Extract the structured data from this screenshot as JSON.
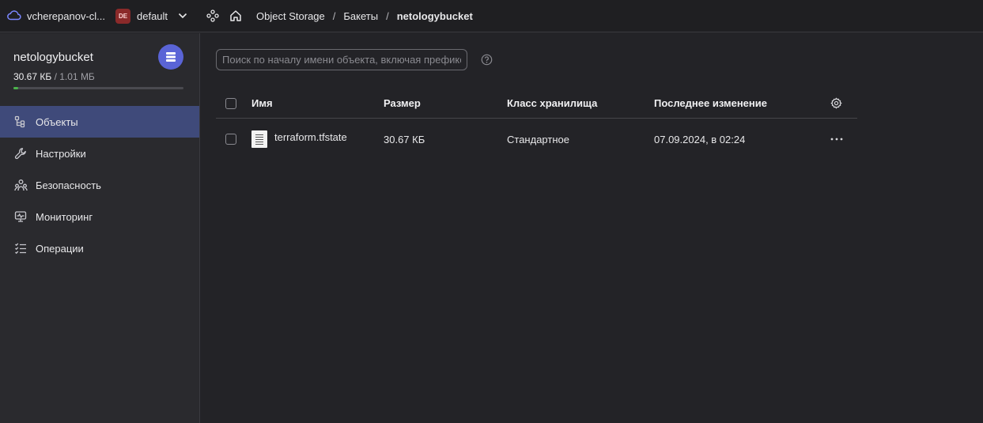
{
  "header": {
    "cloud_name": "vcherepanov-cl...",
    "folder_badge": "DE",
    "folder_name": "default",
    "breadcrumbs": [
      "Object Storage",
      "Бакеты",
      "netologybucket"
    ],
    "separator": "/"
  },
  "sidebar": {
    "bucket_name": "netologybucket",
    "used": "30.67 КБ",
    "slash": " / ",
    "total": "1.01 МБ",
    "usage_fraction": 0.03,
    "items": [
      {
        "label": "Объекты",
        "icon": "objects-icon",
        "active": true
      },
      {
        "label": "Настройки",
        "icon": "wrench-icon",
        "active": false
      },
      {
        "label": "Безопасность",
        "icon": "people-icon",
        "active": false
      },
      {
        "label": "Мониторинг",
        "icon": "monitor-icon",
        "active": false
      },
      {
        "label": "Операции",
        "icon": "list-icon",
        "active": false
      }
    ]
  },
  "search": {
    "placeholder": "Поиск по началу имени объекта, включая префикс"
  },
  "table": {
    "columns": {
      "name": "Имя",
      "size": "Размер",
      "storage_class": "Класс хранилища",
      "modified": "Последнее изменение"
    },
    "rows": [
      {
        "name": "terraform.tfstate",
        "size": "30.67 КБ",
        "storage_class": "Стандартное",
        "modified": "07.09.2024, в 02:24"
      }
    ]
  },
  "colors": {
    "accent": "#5a64d6",
    "active_nav": "#3f4a7a",
    "usage_bar": "#4bb34b",
    "folder_badge": "#8b2a2a"
  }
}
